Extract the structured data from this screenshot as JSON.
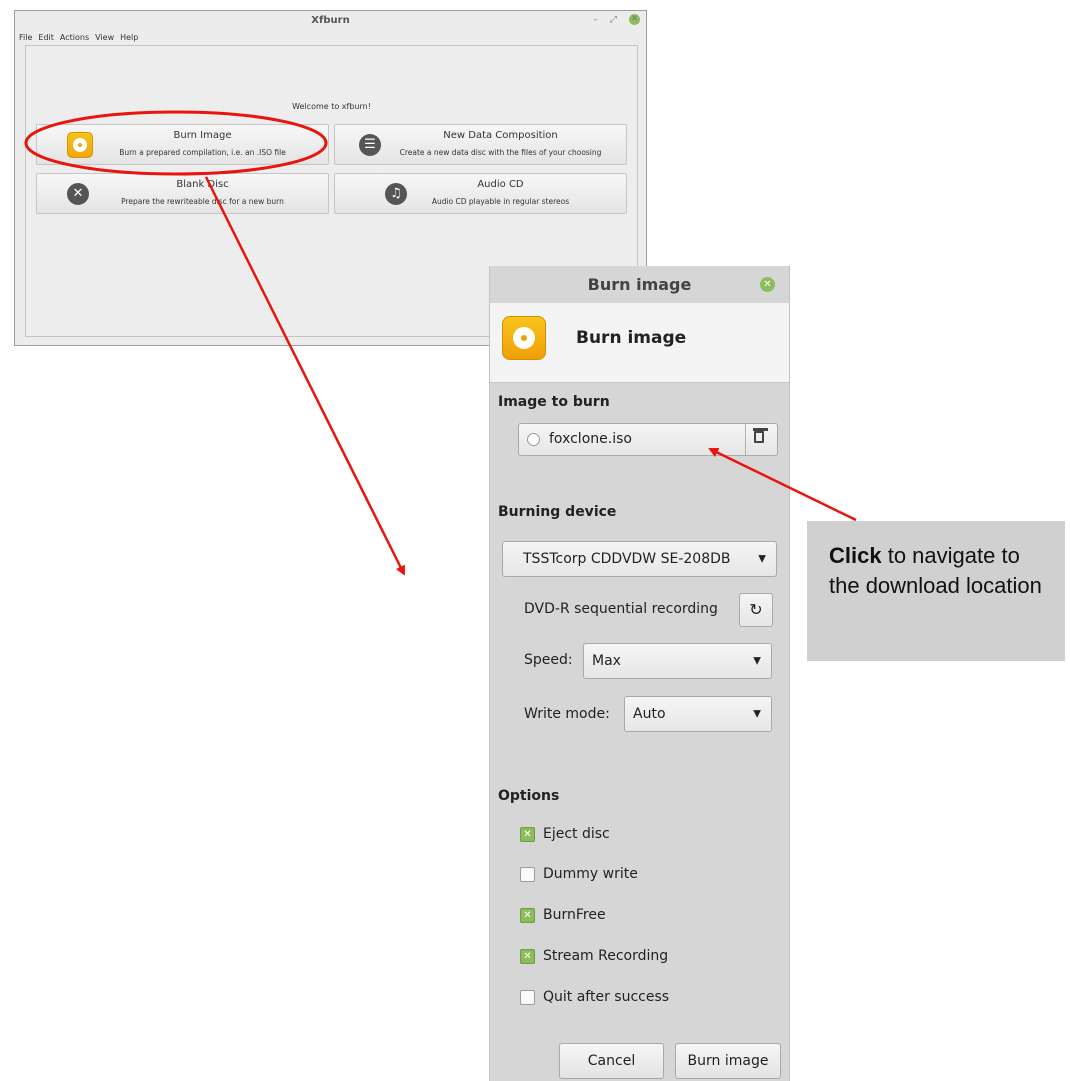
{
  "main_window": {
    "title": "Xfburn",
    "controls": [
      "–",
      "⤢",
      "✕"
    ],
    "menu": [
      "File",
      "Edit",
      "Actions",
      "View",
      "Help"
    ],
    "welcome": "Welcome to xfburn!",
    "actions": [
      {
        "title": "Burn Image",
        "description": "Burn a prepared compilation, i.e. an .ISO file",
        "icon": "disc-icon"
      },
      {
        "title": "New Data Composition",
        "description": "Create a new data disc with the files of your choosing",
        "icon": "list-icon"
      },
      {
        "title": "Blank Disc",
        "description": "Prepare the rewriteable disc for a new burn",
        "icon": "x-circle-icon"
      },
      {
        "title": "Audio CD",
        "description": "Audio CD playable in regular stereos",
        "icon": "music-icon"
      }
    ]
  },
  "dialog": {
    "title": "Burn image",
    "header_title": "Burn image",
    "image_section": "Image to burn",
    "image_file": "foxclone.iso",
    "device_section": "Burning device",
    "device": "TSSTcorp CDDVDW SE-208DB",
    "media_status": "DVD-R sequential recording",
    "speed_label": "Speed:",
    "speed_value": "Max",
    "write_mode_label": "Write mode:",
    "write_mode_value": "Auto",
    "options_section": "Options",
    "options": [
      {
        "label": "Eject disc",
        "checked": true
      },
      {
        "label": "Dummy write",
        "checked": false
      },
      {
        "label": "BurnFree",
        "checked": true
      },
      {
        "label": "Stream Recording",
        "checked": true
      },
      {
        "label": "Quit after success",
        "checked": false
      }
    ],
    "cancel": "Cancel",
    "burn": "Burn image"
  },
  "callout": {
    "bold": "Click",
    "text": "to navigate to the download location"
  },
  "colors": {
    "annotation": "#e8150f",
    "accent_green": "#8bbd5c",
    "disc_orange": "#f0a80c"
  }
}
